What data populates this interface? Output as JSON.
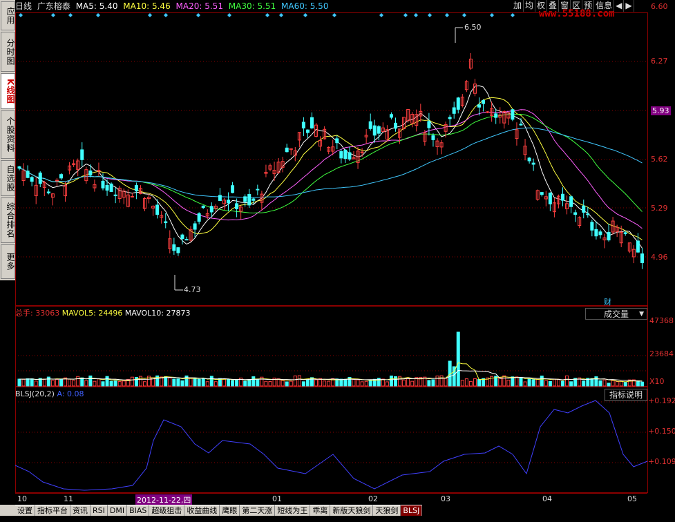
{
  "sidebar": {
    "tabs": [
      {
        "id": "app",
        "label": "应用"
      },
      {
        "id": "intraday",
        "label": "分时图"
      },
      {
        "id": "kline",
        "label": "K线图"
      },
      {
        "id": "profile",
        "label": "个股资料"
      },
      {
        "id": "watchlist",
        "label": "自选股"
      },
      {
        "id": "ranking",
        "label": "综合排名"
      },
      {
        "id": "more",
        "label": "更多"
      }
    ]
  },
  "header": {
    "period": "日线",
    "stock_name": "广东榕泰",
    "ma5": "MA5: 5.40",
    "ma10": "MA10: 5.46",
    "ma20": "MA20: 5.51",
    "ma30": "MA30: 5.51",
    "ma60": "MA60: 5.50"
  },
  "colors": {
    "ma5": "#ffffff",
    "ma10": "#ffff40",
    "ma20": "#ff60ff",
    "ma30": "#40ff40",
    "ma60": "#40c8ff",
    "up": "#ff4040",
    "down": "#40ffff",
    "grid": "#8b0000",
    "axis_text": "#e03030",
    "indicator": "#4040ff"
  },
  "toolbar": [
    "加",
    "均",
    "权",
    "叠",
    "窗",
    "区",
    "预",
    "信息",
    "◀",
    "▶"
  ],
  "watermark": "www.55188.com",
  "price_axis": [
    "6.60",
    "6.27",
    "5.93",
    "5.62",
    "5.29",
    "4.96"
  ],
  "price_marks": {
    "high": "6.50",
    "low": "4.73"
  },
  "finance_badge": "财",
  "volume_panel": {
    "title_label": "总手:",
    "total": "33063",
    "mavol5": "MAVOL5: 24496",
    "mavol10": "MAVOL10: 27873",
    "dropdown": "成交量",
    "axis": [
      "47368",
      "23684",
      "X10"
    ]
  },
  "indicator_panel": {
    "title": "BLSJ(20,2)",
    "value_a": "A: 0.08",
    "button": "指标说明",
    "axis": [
      "+0.192",
      "+0.150",
      "+0.109"
    ]
  },
  "date_axis": {
    "ticks": [
      "10",
      "11",
      "01",
      "02",
      "03",
      "04",
      "05"
    ],
    "highlight": "2012-11-22,四"
  },
  "bottom_tabs": [
    "设置",
    "指标平台",
    "资讯",
    "RSI",
    "DMI",
    "BIAS",
    "超级狙击",
    "收益曲线",
    "鹰眼",
    "第二天涨",
    "短线为王",
    "乖离",
    "新版天狼剑",
    "天狼剑",
    "BLSJ"
  ],
  "active_tab": "BLSJ"
}
